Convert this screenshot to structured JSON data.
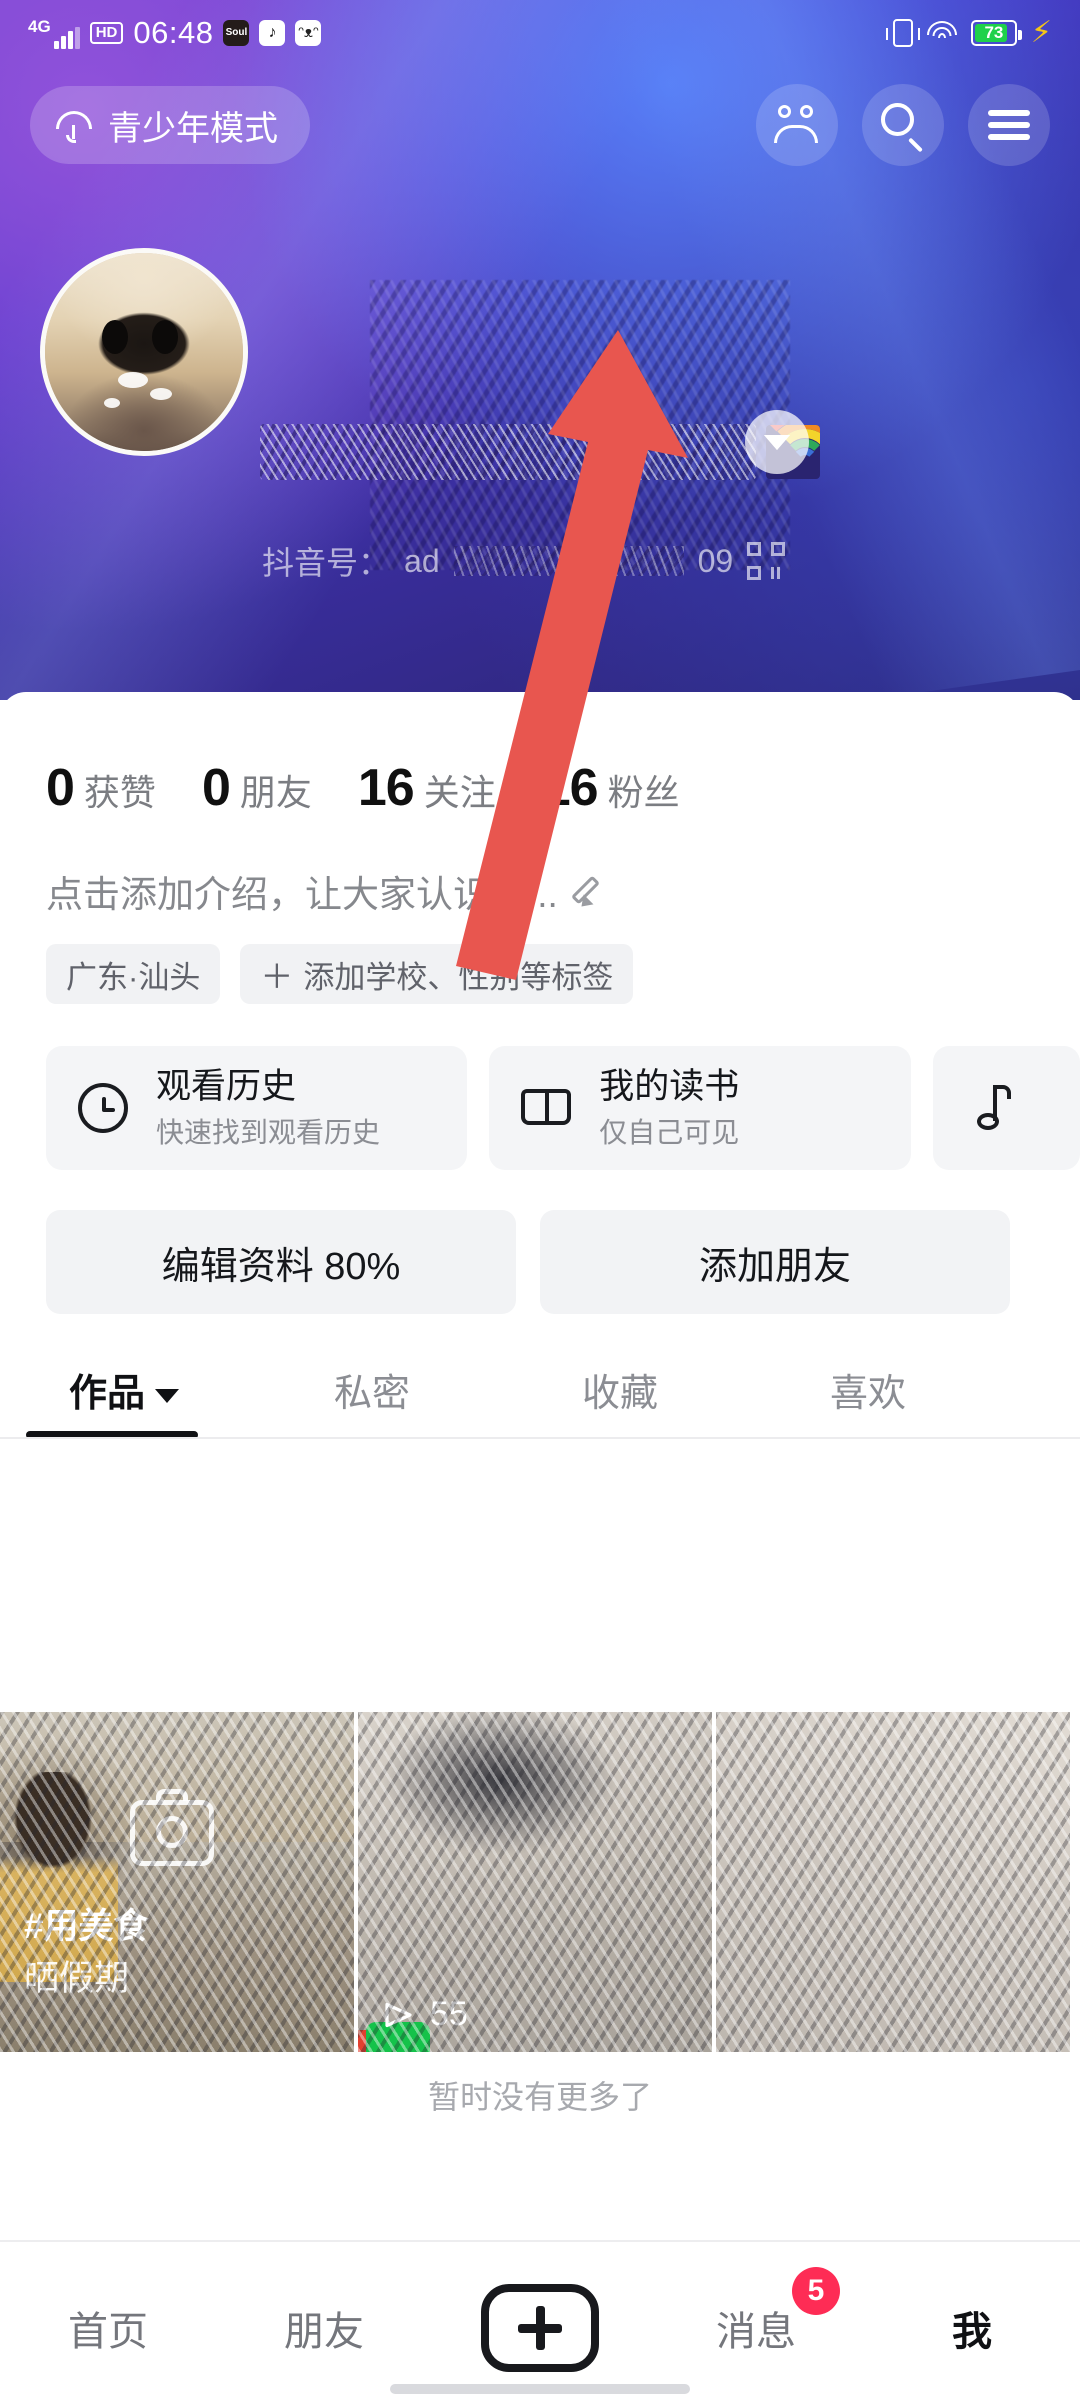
{
  "status_bar": {
    "network": "4G",
    "hd": "HD",
    "time": "06:48",
    "app_icons": [
      "soul-app-icon",
      "douyin-app-icon",
      "cat-app-icon"
    ],
    "vibrate_icon": "vibrate-icon",
    "wifi_icon": "wifi-icon",
    "battery_level": "73",
    "charging_icon": "lightning-bolt-icon",
    "battery_color": "#1fd14b"
  },
  "top_bar": {
    "teen_mode_label": "青少年模式",
    "teen_mode_icon": "umbrella-icon",
    "friends_icon": "people-icon",
    "search_icon": "search-icon",
    "menu_icon": "hamburger-menu-icon"
  },
  "profile": {
    "avatar": "dog-avatar-image",
    "nickname": "",
    "nickname_emoji": "rainbow-emoji",
    "expand_icon": "chevron-down-icon",
    "douyin_id_prefix": "抖音号：",
    "douyin_id_start": "ad",
    "douyin_id_end": "09",
    "qr_icon": "qr-code-icon",
    "stats": [
      {
        "num": "0",
        "label": "获赞"
      },
      {
        "num": "0",
        "label": "朋友"
      },
      {
        "num": "16",
        "label": "关注"
      },
      {
        "num": "16",
        "label": "粉丝"
      }
    ],
    "bio_placeholder": "点击添加介绍，让大家认识你...",
    "bio_edit_icon": "pencil-icon",
    "tags": [
      {
        "text": "广东·汕头",
        "has_plus": false
      },
      {
        "text": "添加学校、性别等标签",
        "has_plus": true,
        "plus": "＋"
      }
    ]
  },
  "feature_cards": [
    {
      "icon": "clock-icon",
      "title": "观看历史",
      "subtitle": "快速找到观看历史"
    },
    {
      "icon": "book-icon",
      "title": "我的读书",
      "subtitle": "仅自己可见"
    },
    {
      "icon": "music-note-icon",
      "title": "",
      "subtitle": ""
    }
  ],
  "actions": [
    {
      "label": "编辑资料 80%"
    },
    {
      "label": "添加朋友"
    }
  ],
  "tabs": [
    {
      "label": "作品",
      "active": true,
      "has_caret": true
    },
    {
      "label": "私密",
      "active": false,
      "has_caret": false
    },
    {
      "label": "收藏",
      "active": false,
      "has_caret": false
    },
    {
      "label": "喜欢",
      "active": false,
      "has_caret": false
    }
  ],
  "videos": [
    {
      "caption_line1": "#用美食",
      "caption_line2": "晒假期",
      "overlay_icon": "camera-icon",
      "play_count": ""
    },
    {
      "caption_line1": "",
      "caption_line2": "",
      "play_icon": "play-icon",
      "play_count": "55"
    },
    {
      "caption_line1": "",
      "caption_line2": "",
      "play_count": ""
    }
  ],
  "list_end_text": "暂时没有更多了",
  "annotation": {
    "arrow_color": "#e8564f",
    "arrow_icon": "pointer-arrow"
  },
  "bottom_nav": {
    "items": [
      {
        "label": "首页",
        "active": false
      },
      {
        "label": "朋友",
        "active": false
      },
      {
        "label": "",
        "active": false,
        "icon": "create-plus-button"
      },
      {
        "label": "消息",
        "active": false,
        "badge": "5"
      },
      {
        "label": "我",
        "active": true
      }
    ],
    "badge_color": "#fe2c55"
  }
}
